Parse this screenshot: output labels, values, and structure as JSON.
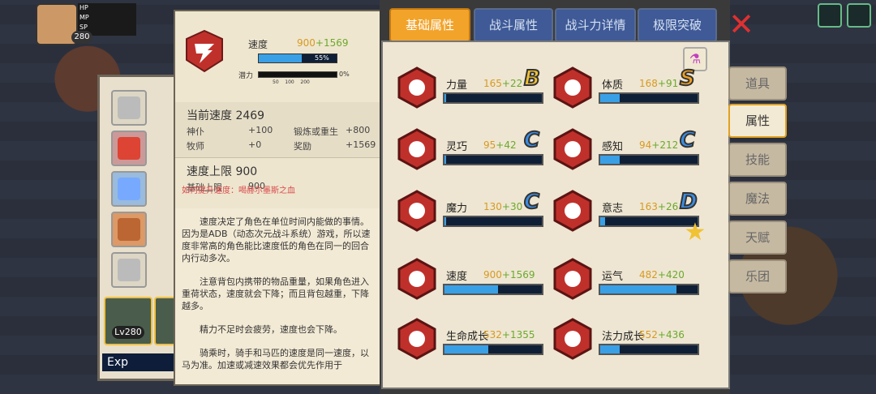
{
  "hud": {
    "level": "280"
  },
  "equipment": {
    "hero_level": "Lv280",
    "exp_label": "Exp"
  },
  "detail": {
    "stat_name": "速度",
    "stat_base": "900",
    "stat_bonus": "+1569",
    "progress_pct": "55%",
    "progress_value": 0.55,
    "potential_label": "潜力",
    "potential_ticks": [
      "50",
      "100",
      "200"
    ],
    "potential_pct": "0%",
    "current_title": "当前速度 2469",
    "current_rows": [
      {
        "k": "神仆",
        "v": "+100",
        "k2": "锻炼或重生",
        "v2": "+800"
      },
      {
        "k": "牧师",
        "v": "+0",
        "k2": "奖励",
        "v2": "+1569"
      }
    ],
    "limit_title": "速度上限 900",
    "limit_k": "基础上限",
    "limit_v": "900",
    "how_to": "如何提升速度：喝赫尔墨斯之血",
    "paragraphs": [
      "速度决定了角色在单位时间内能做的事情。因为是ADB（动态次元战斗系统）游戏，所以速度非常高的角色能比速度低的角色在同一的回合内行动多次。",
      "注意背包内携带的物品重量，如果角色进入重荷状态，速度就会下降；而且背包越重，下降越多。",
      "精力不足时会疲劳，速度也会下降。",
      "骑乘时，骑手和马匹的速度是同一速度，以马为准。加速或减速效果都会优先作用于"
    ]
  },
  "tabs": [
    "基础属性",
    "战斗属性",
    "战斗力详情",
    "极限突破"
  ],
  "side_tabs": [
    "道具",
    "属性",
    "技能",
    "魔法",
    "天赋",
    "乐团"
  ],
  "stats": [
    {
      "name": "力量",
      "base": "165",
      "bonus": "+22",
      "grade": "B",
      "fill": 0.02,
      "icon": "strength-icon"
    },
    {
      "name": "体质",
      "base": "168",
      "bonus": "+91",
      "grade": "S",
      "fill": 0.2,
      "icon": "constitution-icon"
    },
    {
      "name": "灵巧",
      "base": "95",
      "bonus": "+42",
      "grade": "C",
      "fill": 0.02,
      "icon": "agility-icon"
    },
    {
      "name": "感知",
      "base": "94",
      "bonus": "+212",
      "grade": "C",
      "fill": 0.2,
      "icon": "perception-icon"
    },
    {
      "name": "魔力",
      "base": "130",
      "bonus": "+30",
      "grade": "C",
      "fill": 0.02,
      "icon": "magic-icon"
    },
    {
      "name": "意志",
      "base": "163",
      "bonus": "+26",
      "grade": "D",
      "fill": 0.05,
      "icon": "will-icon"
    },
    {
      "name": "速度",
      "base": "900",
      "bonus": "+1569",
      "grade": "",
      "fill": 0.55,
      "icon": "speed-icon"
    },
    {
      "name": "运气",
      "base": "482",
      "bonus": "+420",
      "grade": "",
      "fill": 0.78,
      "icon": "luck-icon"
    },
    {
      "name": "生命成长",
      "base": "532",
      "bonus": "+1355",
      "grade": "",
      "fill": 0.45,
      "icon": "life-growth-icon"
    },
    {
      "name": "法力成长",
      "base": "552",
      "bonus": "+436",
      "grade": "",
      "fill": 0.2,
      "icon": "mana-growth-icon"
    }
  ],
  "colors": {
    "accent": "#f2a32a",
    "tab_blue": "#3f5a97",
    "bar": "#3aa0e6",
    "icon_red": "#c0302b",
    "plus": "#6ca92e",
    "base_orange": "#d79a23"
  }
}
